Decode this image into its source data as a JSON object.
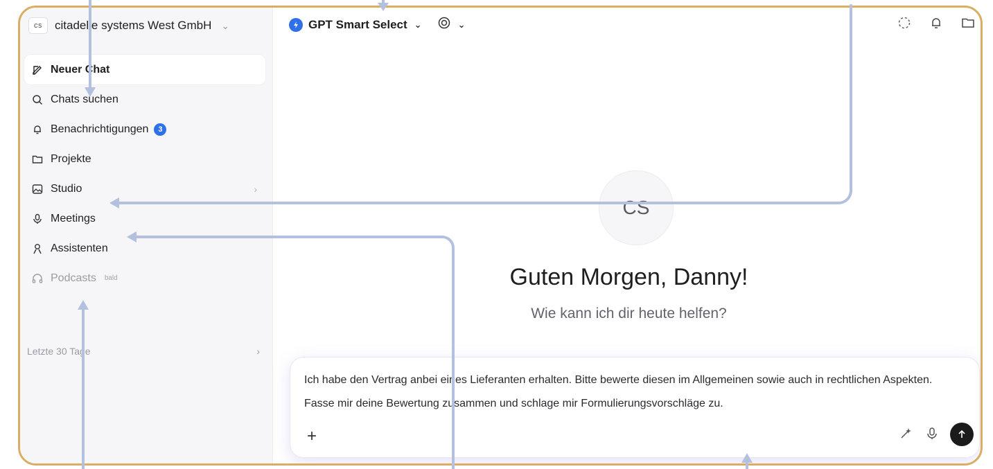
{
  "sidebar": {
    "org_badge": "cs",
    "org_name": "citadelle systems West GmbH",
    "items": [
      {
        "label": "Neuer Chat"
      },
      {
        "label": "Chats suchen"
      },
      {
        "label": "Benachrichtigungen",
        "badge": "3"
      },
      {
        "label": "Projekte"
      },
      {
        "label": "Studio"
      },
      {
        "label": "Meetings"
      },
      {
        "label": "Assistenten"
      },
      {
        "label": "Podcasts",
        "tag": "bald"
      }
    ],
    "recent_label": "Letzte 30 Tage"
  },
  "header": {
    "model_label": "GPT Smart Select"
  },
  "main": {
    "avatar_initials": "CS",
    "greeting": "Guten Morgen, Danny!",
    "subtitle": "Wie kann ich dir heute helfen?"
  },
  "composer": {
    "text": "Ich habe den Vertrag anbei eines Lieferanten erhalten. Bitte bewerte diesen im Allgemeinen sowie auch in rechtlichen Aspekten. Fasse mir deine Bewertung zusammen und schlage mir Formulierungsvorschläge zu."
  },
  "colors": {
    "accent": "#2f6fe8",
    "frame_border": "#d9ad62",
    "annotation_arrow": "#b3c1de"
  }
}
